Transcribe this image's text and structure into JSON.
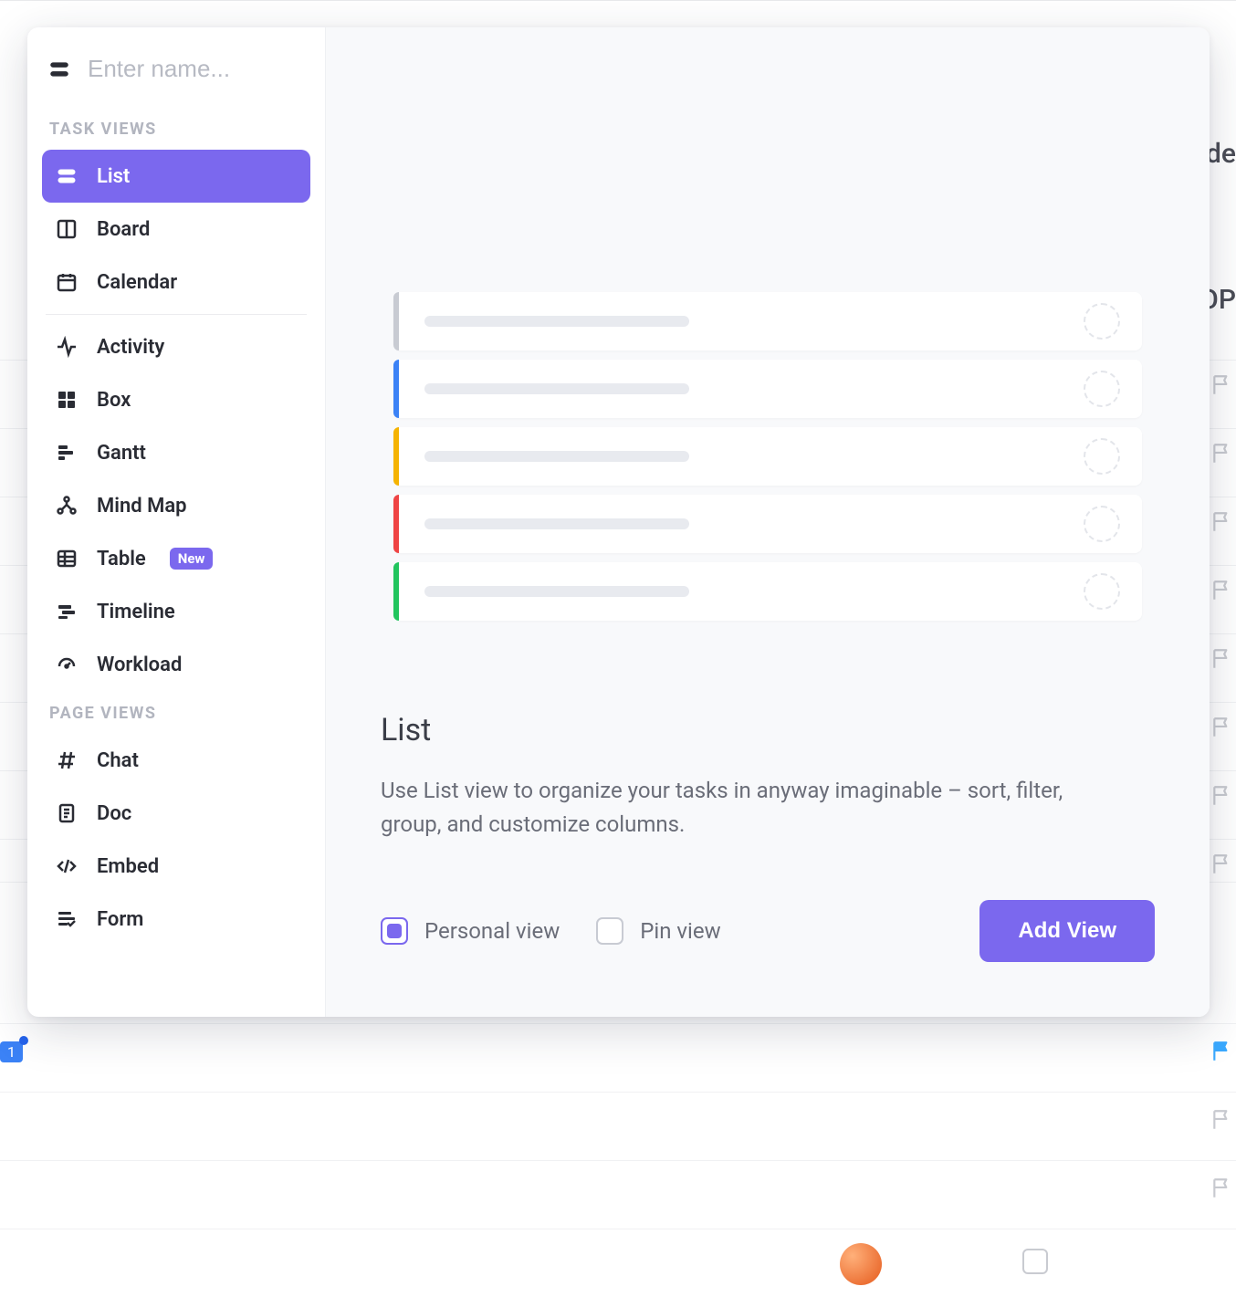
{
  "search": {
    "placeholder": "Enter name..."
  },
  "sections": {
    "task_label": "TASK VIEWS",
    "page_label": "PAGE VIEWS"
  },
  "task_views": {
    "list": {
      "label": "List"
    },
    "board": {
      "label": "Board"
    },
    "calendar": {
      "label": "Calendar"
    },
    "activity": {
      "label": "Activity"
    },
    "box": {
      "label": "Box"
    },
    "gantt": {
      "label": "Gantt"
    },
    "mindmap": {
      "label": "Mind Map"
    },
    "table": {
      "label": "Table",
      "badge": "New"
    },
    "timeline": {
      "label": "Timeline"
    },
    "workload": {
      "label": "Workload"
    }
  },
  "page_views": {
    "chat": {
      "label": "Chat"
    },
    "doc": {
      "label": "Doc"
    },
    "embed": {
      "label": "Embed"
    },
    "form": {
      "label": "Form"
    }
  },
  "detail": {
    "title": "List",
    "description": "Use List view to organize your tasks in anyway imaginable – sort, filter, group, and customize columns.",
    "personal_label": "Personal view",
    "pin_label": "Pin view",
    "add_button": "Add View"
  },
  "preview_row_colors": [
    "#c8cbd2",
    "#3b82f6",
    "#f5b301",
    "#ef4444",
    "#22c55e"
  ],
  "background": {
    "hide_text": "ide",
    "op_text": "OP",
    "badge_value": "1"
  }
}
